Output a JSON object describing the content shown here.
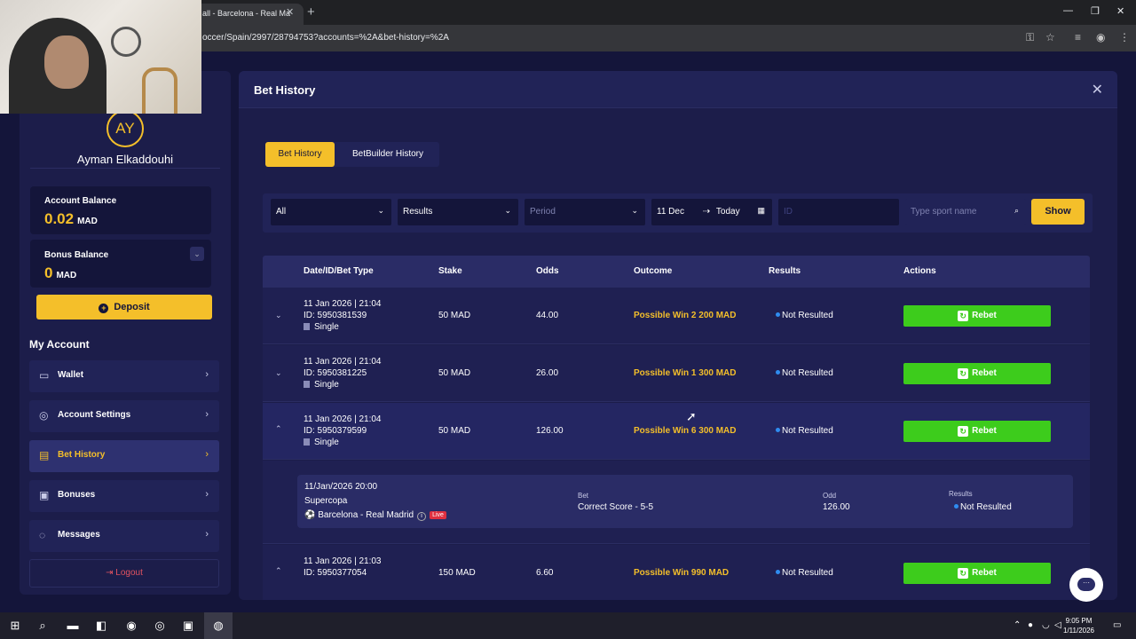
{
  "browser": {
    "tab_title": "all - Barcelona - Real Ma",
    "url": "occer/Spain/2997/28794753?accounts=%2A&bet-history=%2A"
  },
  "sidebar": {
    "avatar_initials": "AY",
    "username": "Ayman Elkaddouhi",
    "account_balance": {
      "label": "Account Balance",
      "value": "0.02",
      "currency": "MAD"
    },
    "bonus_balance": {
      "label": "Bonus Balance",
      "value": "0",
      "currency": "MAD"
    },
    "deposit_label": "Deposit",
    "section_title": "My Account",
    "menu": [
      {
        "label": "Wallet",
        "icon": "wallet-icon"
      },
      {
        "label": "Account Settings",
        "icon": "user-settings-icon"
      },
      {
        "label": "Bet History",
        "icon": "receipt-icon"
      },
      {
        "label": "Bonuses",
        "icon": "gift-icon"
      },
      {
        "label": "Messages",
        "icon": "chat-icon"
      }
    ],
    "logout_label": "Logout"
  },
  "main": {
    "title": "Bet History",
    "tabs": [
      "Bet History",
      "BetBuilder History"
    ],
    "filters": {
      "type": "All",
      "results": "Results",
      "period": "Period",
      "date_from": "11 Dec",
      "date_to": "Today",
      "id_placeholder": "ID",
      "sport_placeholder": "Type sport name",
      "show_label": "Show"
    },
    "columns": [
      "Date/ID/Bet Type",
      "Stake",
      "Odds",
      "Outcome",
      "Results",
      "Actions"
    ],
    "rows": [
      {
        "date": "11 Jan 2026 | 21:04",
        "id": "ID: 5950381539",
        "type": "Single",
        "stake": "50 MAD",
        "odds": "44.00",
        "outcome": "Possible Win 2 200 MAD",
        "result": "Not Resulted",
        "action": "Rebet"
      },
      {
        "date": "11 Jan 2026 | 21:04",
        "id": "ID: 5950381225",
        "type": "Single",
        "stake": "50 MAD",
        "odds": "26.00",
        "outcome": "Possible Win 1 300 MAD",
        "result": "Not Resulted",
        "action": "Rebet"
      },
      {
        "date": "11 Jan 2026 | 21:04",
        "id": "ID: 5950379599",
        "type": "Single",
        "stake": "50 MAD",
        "odds": "126.00",
        "outcome": "Possible Win 6 300 MAD",
        "result": "Not Resulted",
        "action": "Rebet"
      },
      {
        "date": "11 Jan 2026 | 21:03",
        "id": "ID: 5950377054",
        "type": "Single",
        "stake": "150 MAD",
        "odds": "6.60",
        "outcome": "Possible Win 990 MAD",
        "result": "Not Resulted",
        "action": "Rebet"
      }
    ],
    "detail": {
      "datetime": "11/Jan/2026 20:00",
      "competition": "Supercopa",
      "match": "Barcelona - Real Madrid",
      "live_label": "Live",
      "bet_label": "Bet",
      "bet_value": "Correct Score - 5-5",
      "odd_label": "Odd",
      "odd_value": "126.00",
      "results_label": "Results",
      "results_value": "Not Resulted"
    }
  },
  "taskbar": {
    "time": "9:05 PM",
    "date": "1/11/2026"
  }
}
